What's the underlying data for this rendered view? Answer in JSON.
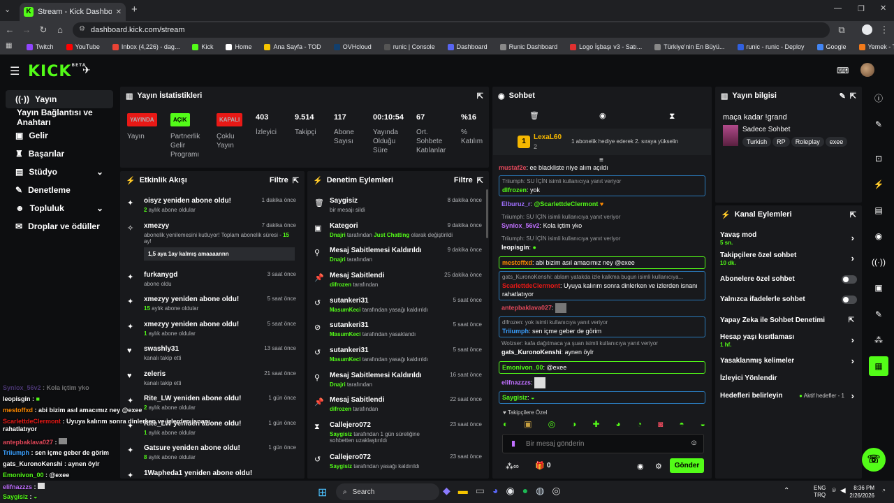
{
  "browser": {
    "tab_title": "Stream - Kick Dashboard",
    "url": "dashboard.kick.com/stream",
    "bookmarks": [
      {
        "label": "Twitch",
        "color": "#9146ff"
      },
      {
        "label": "YouTube",
        "color": "#ff0000"
      },
      {
        "label": "Inbox (4,226) - dag...",
        "color": "#ea4335"
      },
      {
        "label": "Kick",
        "color": "#53fc18"
      },
      {
        "label": "Home",
        "color": "#ffffff"
      },
      {
        "label": "Ana Sayfa - TOD",
        "color": "#f5c400"
      },
      {
        "label": "OVHcloud",
        "color": "#123f6d"
      },
      {
        "label": "runic | Console",
        "color": "#555555"
      },
      {
        "label": "Dashboard",
        "color": "#5865f2"
      },
      {
        "label": "Runic Dashboard",
        "color": "#888888"
      },
      {
        "label": "Logo İşbaşı v3 - Satı...",
        "color": "#e03030"
      },
      {
        "label": "Türkiye'nin En Büyü...",
        "color": "#888888"
      },
      {
        "label": "runic - runic - Deploy",
        "color": "#3060e0"
      },
      {
        "label": "Google",
        "color": "#4285f4"
      },
      {
        "label": "Yemek - Trendyol Go",
        "color": "#f27a1a"
      }
    ]
  },
  "sidebar": {
    "items": [
      {
        "label": "Yayın",
        "icon": "broadcast-icon"
      },
      {
        "label": "Yayın Bağlantısı ve Anahtarı",
        "icon": ""
      },
      {
        "label": "Gelir",
        "icon": "revenue-icon"
      },
      {
        "label": "Başarılar",
        "icon": "trophy-icon"
      },
      {
        "label": "Stüdyo",
        "icon": "studio-icon"
      },
      {
        "label": "Denetleme",
        "icon": "wrench-icon"
      },
      {
        "label": "Topluluk",
        "icon": "people-icon"
      },
      {
        "label": "Droplar ve ödüller",
        "icon": "gift-icon"
      }
    ]
  },
  "stats": {
    "title": "Yayın İstatistikleri",
    "items": [
      {
        "badge": "YAYINDA",
        "label": "Yayın",
        "badge_color": "#e91916"
      },
      {
        "badge": "AÇIK",
        "label": "Partnerlik Gelir Programı",
        "badge_color": "#53fc18"
      },
      {
        "badge": "KAPALI",
        "label": "Çoklu Yayın",
        "badge_color": "#e91916"
      },
      {
        "value": "403",
        "label": "İzleyici"
      },
      {
        "value": "9.514",
        "label": "Takipçi"
      },
      {
        "value": "117",
        "label": "Abone Sayısı"
      },
      {
        "value": "00:10:54",
        "label": "Yayında Olduğu Süre"
      },
      {
        "value": "67",
        "label": "Ort. Sohbete Katılanlar"
      },
      {
        "value": "%16",
        "label": "% Katılım"
      }
    ]
  },
  "activity": {
    "title": "Etkinlik Akışı",
    "filter": "Filtre",
    "events": [
      {
        "title": "oisyz yeniden abone oldu!",
        "sub_green": "2",
        "sub": " aylık abone oldular",
        "time": "1 dakika önce"
      },
      {
        "title": "xmezyy",
        "sub": "abonelik yenilemesini kutluyor! Toplam abonelik süresi - ",
        "sub_green": "15",
        "sub2": " ay!",
        "quote": "1,5 aya 1ay kalmış amaaaannn",
        "time": "7 dakika önce"
      },
      {
        "title": "furkanygd",
        "sub": "abone oldu",
        "time": "3 saat önce"
      },
      {
        "title": "xmezyy yeniden abone oldu!",
        "sub_green": "15",
        "sub": " aylık abone oldular",
        "time": "5 saat önce"
      },
      {
        "title": "xmezyy yeniden abone oldu!",
        "sub_green": "1",
        "sub": " aylık abone oldular",
        "time": "5 saat önce"
      },
      {
        "title": "swashly31",
        "sub": "kanalı takip etti",
        "time": "13 saat önce"
      },
      {
        "title": "zeleris",
        "sub": "kanalı takip etti",
        "time": "21 saat önce"
      },
      {
        "title": "Rite_LW yeniden abone oldu!",
        "sub_green": "2",
        "sub": " aylık abone oldular",
        "time": "1 gün önce"
      },
      {
        "title": "Rite_LW yeniden abone oldu!",
        "sub_green": "1",
        "sub": " aylık abone oldular",
        "time": "1 gün önce"
      },
      {
        "title": "Gatsure yeniden abone oldu!",
        "sub_green": "8",
        "sub": " aylık abone oldular",
        "time": "1 gün önce"
      },
      {
        "title": "1Wapheda1 yeniden abone oldu!",
        "sub": "",
        "time": ""
      }
    ]
  },
  "moderation": {
    "title": "Denetim Eylemleri",
    "filter": "Filtre",
    "items": [
      {
        "title": "Saygisiz",
        "who": "",
        "sub": "bir mesajı sildi",
        "time": "8 dakika önce"
      },
      {
        "title": "Kategori",
        "who": "Dnajri",
        "sub": " tarafından ",
        "extra": "Just Chatting",
        "sub2": " olarak değiştirildi",
        "time": "9 dakika önce"
      },
      {
        "title": "Mesaj Sabitlemesi Kaldırıldı",
        "who": "Dnajri",
        "sub": " tarafından",
        "time": "9 dakika önce"
      },
      {
        "title": "Mesaj Sabitlendi",
        "who": "difrozen",
        "sub": " tarafından",
        "time": "25 dakika önce"
      },
      {
        "title": "sutankeri31",
        "who": "MasumKeci",
        "sub": " tarafından yasağı kaldırıldı",
        "time": "5 saat önce"
      },
      {
        "title": "sutankeri31",
        "who": "MasumKeci",
        "sub": " tarafından yasaklandı",
        "time": "5 saat önce"
      },
      {
        "title": "sutankeri31",
        "who": "MasumKeci",
        "sub": " tarafından yasağı kaldırıldı",
        "time": "5 saat önce"
      },
      {
        "title": "Mesaj Sabitlemesi Kaldırıldı",
        "who": "Dnajri",
        "sub": " tarafından",
        "time": "16 saat önce"
      },
      {
        "title": "Mesaj Sabitlendi",
        "who": "difrozen",
        "sub": " tarafından",
        "time": "22 saat önce"
      },
      {
        "title": "Callejero072",
        "who": "Saygisiz",
        "sub": " tarafından 1 gün süreliğine sohbetten uzaklaştırıldı",
        "time": "23 saat önce"
      },
      {
        "title": "Callejero072",
        "who": "Saygisiz",
        "sub": " tarafından yasağı kaldırıldı",
        "time": "23 saat önce"
      }
    ]
  },
  "chat": {
    "title": "Sohbet",
    "pinned_user": "LexaL60",
    "pinned_level": "2",
    "pinned_text": "1 abonelik hediye ederek 2. sıraya yükselin",
    "messages": [
      {
        "user": "mustaf2e",
        "color": "#e0485a",
        "text": "ee blackliste niye alım açıldı"
      },
      {
        "reply": "Triiumph: SU İÇİN isimli kullanıcıya yanıt veriyor",
        "user": "dlfrozen",
        "color": "#53fc18",
        "text": "yok"
      },
      {
        "user": "Elburuz_r",
        "color": "#a070ff",
        "text": "@ScarlettdeClermont"
      },
      {
        "reply": "Triiumph: SU İÇİN isimli kullanıcıya yanıt veriyor",
        "user": "Synlox_56v2",
        "color": "#c070ff",
        "text": "Kola içtim yko"
      },
      {
        "reply": "Triiumph: SU İÇİN isimli kullanıcıya yanıt veriyor",
        "user": "leopisgin",
        "color": "#ffffff",
        "text": ""
      },
      {
        "user": "mestoffxd",
        "color": "#ff8a00",
        "text": "abi bizim asıl amacımız ney @exee"
      },
      {
        "reply": "gats_KuronoKenshi: ablam yatakda izle kalkma bugun isimli kullanıcıya...",
        "user": "ScarlettdeClermont",
        "color": "#e91916",
        "text": "Uyuya kalırım sonra dinlerken ve izlerden isnanı rahatlatıyor"
      },
      {
        "user": "antepbaklava027",
        "color": "#e0485a",
        "text": ""
      },
      {
        "reply": "dlfrozen: yok isimli kullanıcıya yanıt veriyor",
        "user": "Triiumph",
        "color": "#3aa0ff",
        "text": "sen içme geber de görim"
      },
      {
        "reply": "Wolzser: kafa dağıtmaca ya şuan isimli kullanıcıya yanıt veriyor",
        "user": "gats_KuronoKenshi",
        "color": "#ffffff",
        "text": "aynen öylr"
      },
      {
        "user": "Emonivon_00",
        "color": "#53fc18",
        "text": "@exee"
      },
      {
        "user": "elifnazzzs",
        "color": "#c070ff",
        "text": ""
      },
      {
        "user": "Saygisiz",
        "color": "#53fc18",
        "text": ""
      }
    ],
    "emote_section": "Takipçilere Özel",
    "input_placeholder": "Bir mesaj gönderin",
    "points": "0",
    "send": "Gönder"
  },
  "stream_info": {
    "title": "Yayın bilgisi",
    "stream_title": "maça kadar !grand",
    "category": "Sadece Sohbet",
    "tags": [
      "Turkish",
      "RP",
      "Roleplay",
      "exee"
    ]
  },
  "channel_actions": {
    "title": "Kanal Eylemleri",
    "items": [
      {
        "label": "Yavaş mod",
        "sub": "5 sn.",
        "control": "arrow"
      },
      {
        "label": "Takipçilere özel sohbet",
        "sub": "10 dk.",
        "control": "arrow"
      },
      {
        "label": "Abonelere özel sohbet",
        "sub": "",
        "control": "toggle"
      },
      {
        "label": "Yalnızca ifadelerle sohbet",
        "sub": "",
        "control": "toggle"
      },
      {
        "label": "Yapay Zeka ile Sohbet Denetimi",
        "sub": "",
        "control": "external"
      },
      {
        "label": "Hesap yaşı kısıtlaması",
        "sub": "1 hf.",
        "control": "arrow"
      },
      {
        "label": "Yasaklanmış kelimeler",
        "sub": "",
        "control": "arrow"
      },
      {
        "label": "İzleyici Yönlendir",
        "sub": "",
        "control": ""
      },
      {
        "label": "Hedefleri belirleyin",
        "sub": "",
        "status": "Aktif hedefler - 1",
        "control": "arrow"
      }
    ]
  },
  "overlay_chat": [
    {
      "user": "Synlox_56v2",
      "color": "#a070ff",
      "text": "Kola içtim yko"
    },
    {
      "user": "leopisgin",
      "color": "#ffffff",
      "text": ""
    },
    {
      "user": "mestoffxd",
      "color": "#ff8a00",
      "text": "abi bizim asıl amacımız ney @exee"
    },
    {
      "user": "ScarlettdeClermont",
      "color": "#e91916",
      "text": "Uyuya kalırım sonra dinlerken ve izlerden isnanı rahatlatıyor"
    },
    {
      "user": "antepbaklava027",
      "color": "#e0485a",
      "text": ""
    },
    {
      "user": "Triiumph",
      "color": "#3aa0ff",
      "text": "sen içme geber de görim"
    },
    {
      "user": "gats_KuronoKenshi",
      "color": "#ffffff",
      "text": "aynen öylr"
    },
    {
      "user": "Emonivon_00",
      "color": "#53fc18",
      "text": "@exee"
    },
    {
      "user": "elifnazzzs",
      "color": "#c070ff",
      "text": ""
    },
    {
      "user": "Saygisiz",
      "color": "#53fc18",
      "text": ""
    }
  ],
  "taskbar": {
    "search": "Search",
    "lang1": "ENG",
    "lang2": "TRQ",
    "time": "8:36 PM",
    "date": "2/26/2026"
  },
  "colors": {
    "accent": "#53fc18",
    "live": "#e91916",
    "panel": "#18191c",
    "bg": "#0d0e10"
  }
}
